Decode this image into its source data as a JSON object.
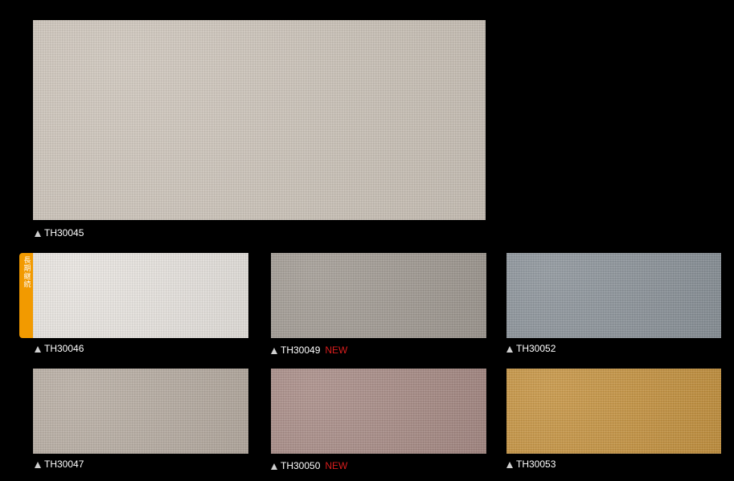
{
  "swatches": [
    {
      "code": "TH30045",
      "is_new": false,
      "color": "#cfc6bb"
    },
    {
      "code": "TH30046",
      "is_new": false,
      "color": "#ece8e3",
      "tag": "長期継続"
    },
    {
      "code": "TH30049",
      "is_new": true,
      "color": "#a19a92"
    },
    {
      "code": "TH30052",
      "is_new": false,
      "color": "#8a9299"
    },
    {
      "code": "TH30047",
      "is_new": false,
      "color": "#b8ada2"
    },
    {
      "code": "TH30050",
      "is_new": true,
      "color": "#a88a84"
    },
    {
      "code": "TH30053",
      "is_new": false,
      "color": "#c7923b"
    }
  ],
  "new_label": "NEW",
  "colors": {
    "background": "#000000",
    "new_text": "#d81d1d",
    "tag_bg": "#f29a00"
  }
}
